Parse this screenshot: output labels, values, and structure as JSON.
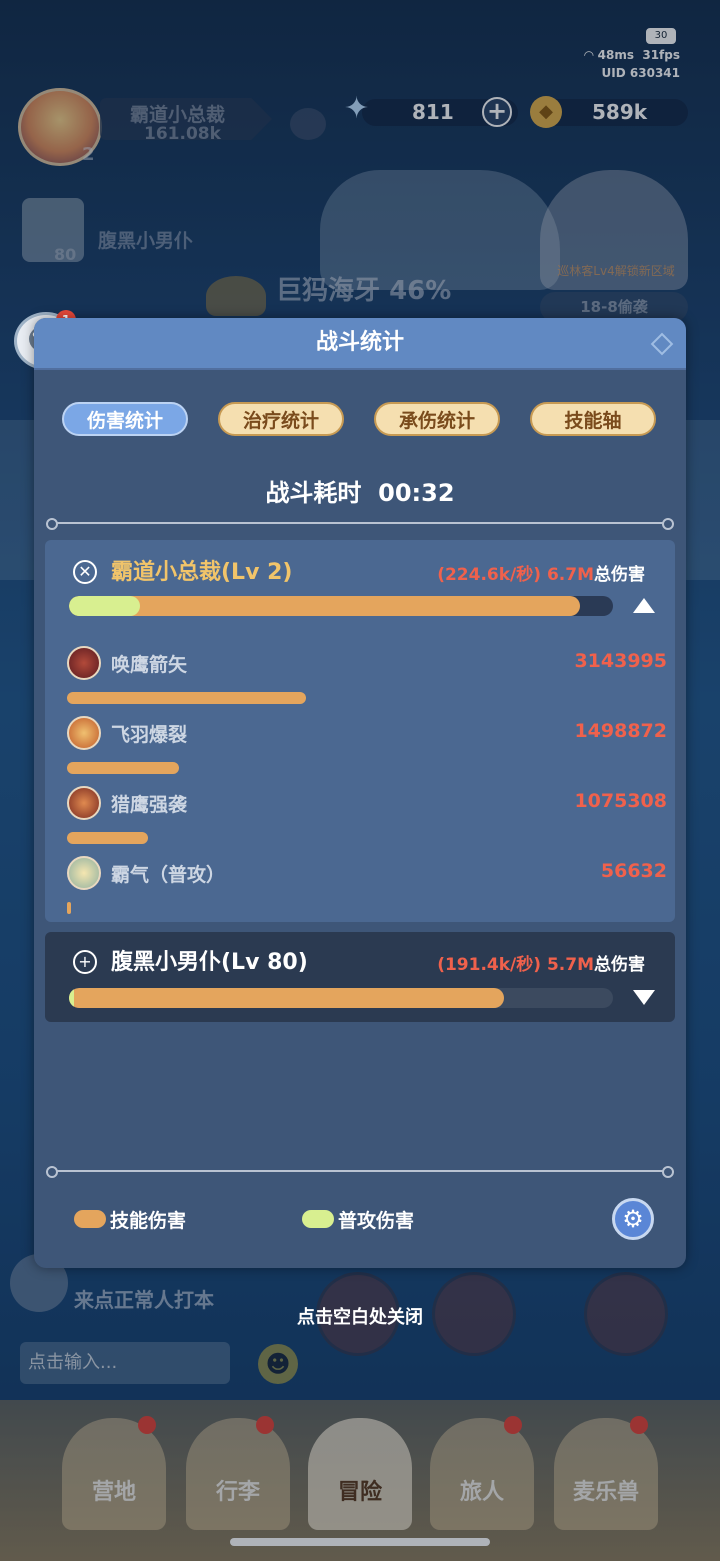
{
  "status": {
    "battery": "30",
    "ping": "48ms",
    "fps": "31fps",
    "uid": "UID 630341"
  },
  "resources": {
    "gems": "811",
    "gold": "589k"
  },
  "players": [
    {
      "name": "霸道小总裁",
      "power": "161.08k",
      "level": "2"
    },
    {
      "name": "腹黑小男仆",
      "level": "80"
    }
  ],
  "boss": {
    "name": "巨犸海牙",
    "percent": "46%"
  },
  "right_card": {
    "text": "巡林客Lv4解锁新区域",
    "stage": "18-8偷袭"
  },
  "chat_badge": "1",
  "panel": {
    "title": "战斗统计",
    "tabs": [
      {
        "label": "伤害统计",
        "active": true
      },
      {
        "label": "治疗统计",
        "active": false
      },
      {
        "label": "承伤统计",
        "active": false
      },
      {
        "label": "技能轴",
        "active": false
      }
    ],
    "timer_label": "战斗耗时",
    "timer_value": "00:32",
    "heroes": [
      {
        "name": "霸道小总裁(Lv 2)",
        "dps": "(224.6k/秒)",
        "total": "6.7M",
        "total_suffix": "总伤害",
        "skill_fraction": 0.94,
        "atk_fraction": 0.13,
        "expanded": true,
        "skills": [
          {
            "name": "唤鹰箭矢",
            "value": "3143995",
            "fraction": 0.47
          },
          {
            "name": "飞羽爆裂",
            "value": "1498872",
            "fraction": 0.22
          },
          {
            "name": "猎鹰强袭",
            "value": "1075308",
            "fraction": 0.16
          },
          {
            "name": "霸气（普攻）",
            "value": "56632",
            "fraction": 0.008
          }
        ]
      },
      {
        "name": "腹黑小男仆(Lv 80)",
        "dps": "(191.4k/秒)",
        "total": "5.7M",
        "total_suffix": "总伤害",
        "skill_fraction": 0.8,
        "atk_fraction": 0.01,
        "expanded": false
      }
    ],
    "legend": {
      "skill": "技能伤害",
      "atk": "普攻伤害"
    }
  },
  "close_hint": "点击空白处关闭",
  "chat_preview": "来点正常人打本",
  "chat_input_placeholder": "点击输入...",
  "nav": [
    "营地",
    "行李",
    "冒险",
    "旅人",
    "麦乐兽"
  ],
  "colors": {
    "skill": "#e4a55d",
    "atk": "#d8ef90",
    "hero_name": "#f1c46a",
    "dps": "#f0614c",
    "value": "#f0614c",
    "header": "#6189c2",
    "panel": "#3e5678"
  }
}
